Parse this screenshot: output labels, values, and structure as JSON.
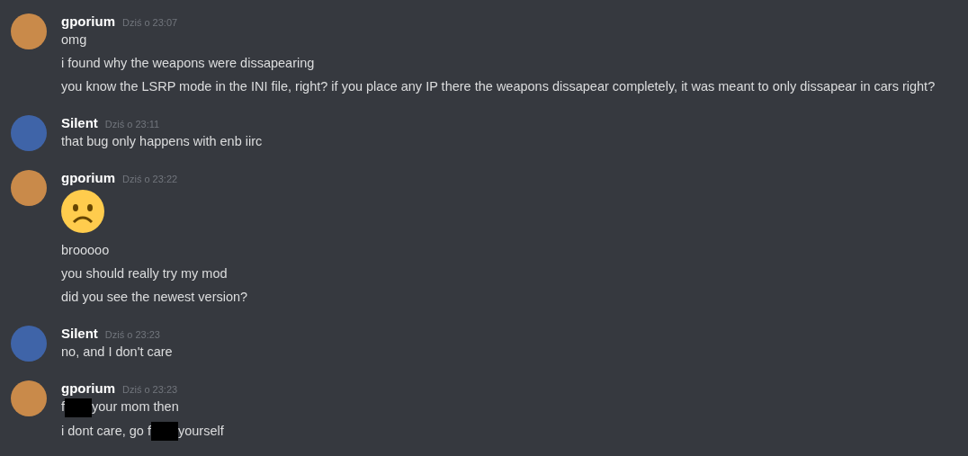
{
  "messages": [
    {
      "author": "gporium",
      "timestamp": "Dziś o 23:07",
      "color": "#c98a4a",
      "lines": [
        [
          {
            "kind": "text",
            "text": "omg"
          }
        ],
        [
          {
            "kind": "text",
            "text": "i found why the weapons were dissapearing"
          }
        ],
        [
          {
            "kind": "text",
            "text": "you know the LSRP mode in the INI file, right? if you place any IP there the weapons dissapear completely, it was meant to only dissapear in cars right?"
          }
        ]
      ]
    },
    {
      "author": "Silent",
      "timestamp": "Dziś o 23:11",
      "color": "#3f64a8",
      "lines": [
        [
          {
            "kind": "text",
            "text": "that bug only happens with enb iirc"
          }
        ]
      ]
    },
    {
      "author": "gporium",
      "timestamp": "Dziś o 23:22",
      "color": "#c98a4a",
      "lines": [
        [
          {
            "kind": "emoji"
          }
        ],
        [
          {
            "kind": "text",
            "text": "brooooo"
          }
        ],
        [
          {
            "kind": "text",
            "text": "you should really try my mod"
          }
        ],
        [
          {
            "kind": "text",
            "text": "did you see the newest version?"
          }
        ]
      ]
    },
    {
      "author": "Silent",
      "timestamp": "Dziś o 23:23",
      "color": "#3f64a8",
      "lines": [
        [
          {
            "kind": "text",
            "text": "no, and I don't care"
          }
        ]
      ]
    },
    {
      "author": "gporium",
      "timestamp": "Dziś o 23:23",
      "color": "#c98a4a",
      "lines": [
        [
          {
            "kind": "text",
            "text": "f"
          },
          {
            "kind": "redacted"
          },
          {
            "kind": "text",
            "text": "your mom then"
          }
        ],
        [
          {
            "kind": "text",
            "text": "i dont care, go f"
          },
          {
            "kind": "redacted"
          },
          {
            "kind": "text",
            "text": "yourself"
          }
        ]
      ]
    }
  ]
}
